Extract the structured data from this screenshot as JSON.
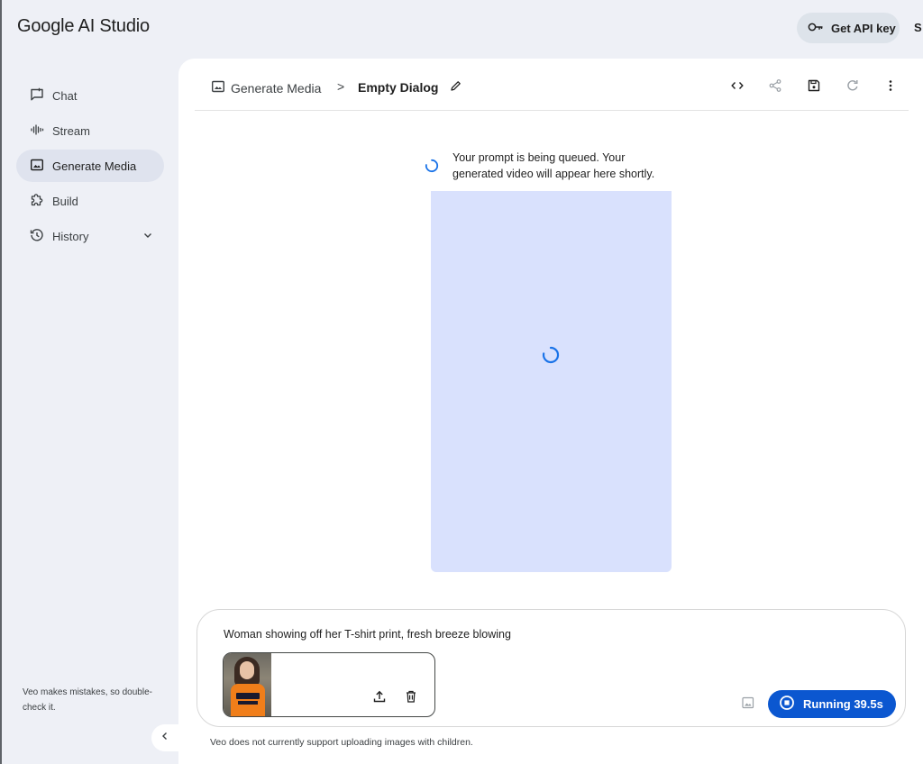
{
  "app": {
    "logo_brand": "Google",
    "logo_product": " AI Studio",
    "get_api_key_label": "Get API key",
    "top_right_partial": "S"
  },
  "sidebar": {
    "items": [
      {
        "label": "Chat",
        "icon": "chat-icon"
      },
      {
        "label": "Stream",
        "icon": "stream-waveform-icon"
      },
      {
        "label": "Generate Media",
        "icon": "media-icon",
        "active": true
      },
      {
        "label": "Build",
        "icon": "puzzle-icon"
      },
      {
        "label": "History",
        "icon": "history-icon",
        "expandable": true
      }
    ],
    "disclaimer": "Veo makes mistakes, so double-check it."
  },
  "header": {
    "breadcrumb_section": "Generate Media",
    "breadcrumb_separator": ">",
    "title": "Empty Dialog",
    "actions": [
      "code-icon",
      "share-icon",
      "save-icon",
      "refresh-icon",
      "more-vert-icon"
    ]
  },
  "result": {
    "queue_message": "Your prompt is being queued. Your generated video will appear here shortly."
  },
  "prompt": {
    "text": "Woman showing off her T-shirt print, fresh breeze blowing",
    "run_label": "Running 39.5s",
    "bottom_disclaimer": "Veo does not currently support uploading images with children."
  },
  "colors": {
    "accent": "#0b57d0",
    "placeholder_fill": "#d9e1fd",
    "sidebar_active": "#dfe3ee",
    "spinner": "#1a73e8"
  }
}
